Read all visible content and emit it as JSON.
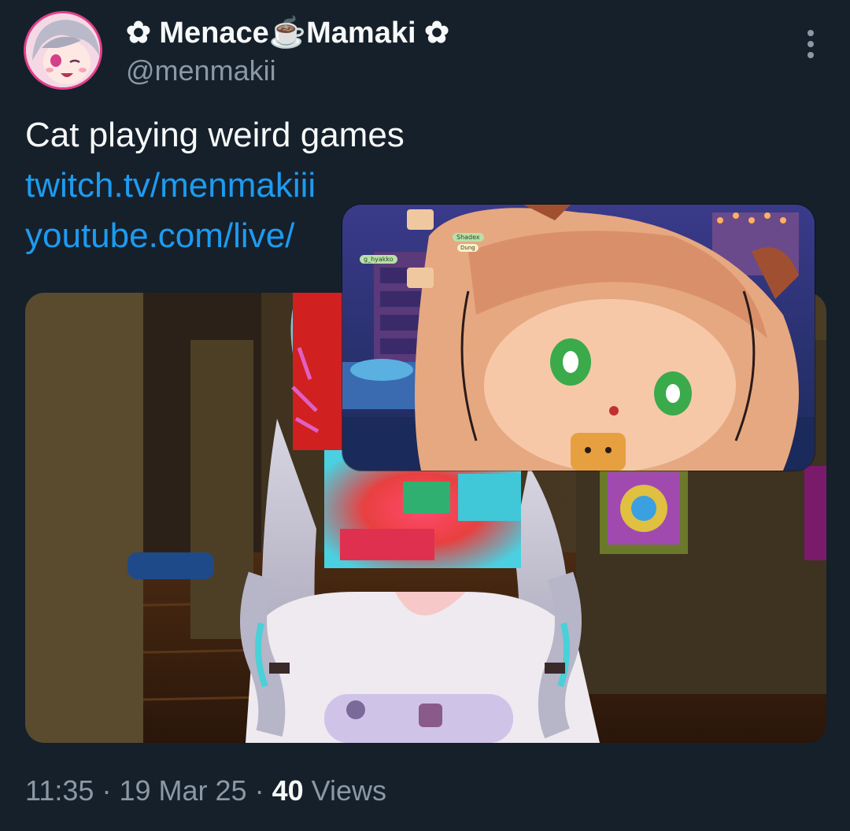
{
  "author": {
    "display_name": "✿ Menace☕Mamaki ✿",
    "handle": "@menmakii"
  },
  "tweet": {
    "text": "Cat playing weird games",
    "links": [
      "twitch.tv/menmakiii",
      "youtube.com/live/"
    ]
  },
  "stream_overlay": {
    "chat_names": [
      "g_hyakko",
      "Shadex"
    ],
    "chat_message": "Dung"
  },
  "meta": {
    "time": "11:35",
    "date": "19 Mar 25",
    "views_count": "40",
    "views_label": "Views",
    "separator": "·"
  },
  "icons": {
    "more": "more-vertical-icon"
  },
  "colors": {
    "background": "#15202b",
    "text": "#f7f9f9",
    "secondary": "#8b98a5",
    "link": "#1d9bf0",
    "avatar_ring": "#e0408a"
  }
}
